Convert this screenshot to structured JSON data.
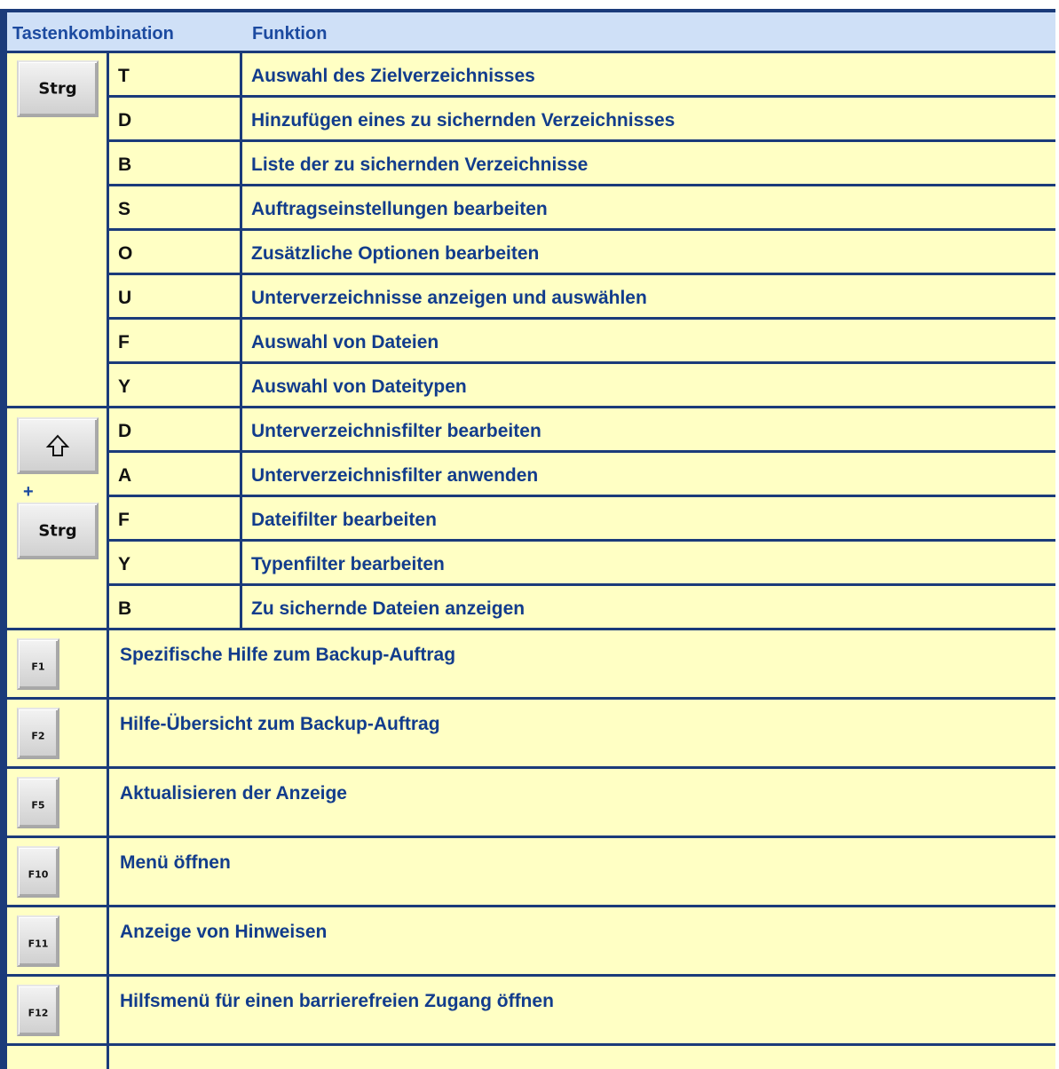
{
  "header": {
    "col1": "Tastenkombination",
    "col2": "Funktion"
  },
  "groups": {
    "strg": {
      "key_label": "Strg",
      "rows": [
        {
          "key": "T",
          "func": "Auswahl des Zielverzeichnisses"
        },
        {
          "key": "D",
          "func": "Hinzufügen eines zu sichernden Verzeichnisses"
        },
        {
          "key": "B",
          "func": "Liste der zu sichernden Verzeichnisse"
        },
        {
          "key": "S",
          "func": "Auftragseinstellungen bearbeiten"
        },
        {
          "key": "O",
          "func": "Zusätzliche Optionen bearbeiten"
        },
        {
          "key": "U",
          "func": "Unterverzeichnisse anzeigen und auswählen"
        },
        {
          "key": "F",
          "func": "Auswahl von Dateien"
        },
        {
          "key": "Y",
          "func": "Auswahl von Dateitypen"
        }
      ]
    },
    "shift_strg": {
      "shift_icon": "shift-arrow-icon",
      "plus": "+",
      "key_label": "Strg",
      "rows": [
        {
          "key": "D",
          "func": "Unterverzeichnisfilter bearbeiten"
        },
        {
          "key": "A",
          "func": "Unterverzeichnisfilter anwenden"
        },
        {
          "key": "F",
          "func": "Dateifilter bearbeiten"
        },
        {
          "key": "Y",
          "func": "Typenfilter bearbeiten"
        },
        {
          "key": "B",
          "func": "Zu sichernde Dateien anzeigen"
        }
      ]
    }
  },
  "function_keys": [
    {
      "key": "F1",
      "func": "Spezifische Hilfe zum Backup-Auftrag"
    },
    {
      "key": "F2",
      "func": "Hilfe-Übersicht zum Backup-Auftrag"
    },
    {
      "key": "F5",
      "func": "Aktualisieren der Anzeige"
    },
    {
      "key": "F10",
      "func": "Menü öffnen"
    },
    {
      "key": "F11",
      "func": "Anzeige von Hinweisen"
    },
    {
      "key": "F12",
      "func": "Hilfsmenü für einen barrierefreien Zugang öffnen"
    }
  ],
  "colors": {
    "header_bg": "#cfe0f7",
    "cell_bg": "#ffffc4",
    "border": "#1b3b7a",
    "text_blue": "#123c8c"
  }
}
